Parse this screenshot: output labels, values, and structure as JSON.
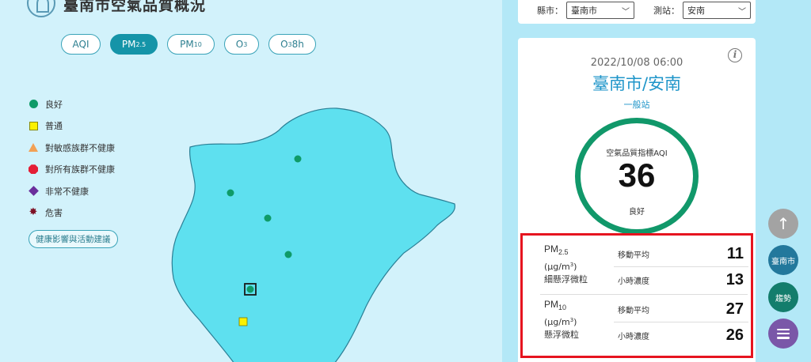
{
  "header": {
    "title": "臺南市空氣品質概況",
    "logo_icon": "leaf-logo-icon"
  },
  "tabs": [
    {
      "main": "AQI",
      "sub": ""
    },
    {
      "main": "PM",
      "sub": "2.5"
    },
    {
      "main": "PM",
      "sub": "10"
    },
    {
      "main": "O",
      "sub": "3"
    },
    {
      "main": "O",
      "sub": "3",
      "suffix": " 8h"
    }
  ],
  "active_tab_index": 1,
  "legend": {
    "items": [
      {
        "label": "良好",
        "marker": "green-circle",
        "color": "#0f9b68"
      },
      {
        "label": "普通",
        "marker": "yellow-square",
        "color": "#fcf100"
      },
      {
        "label": "對敏感族群不健康",
        "marker": "orange-triangle",
        "color": "#f2a155"
      },
      {
        "label": "對所有族群不健康",
        "marker": "red-octagon",
        "color": "#e41e36"
      },
      {
        "label": "非常不健康",
        "marker": "purple-diamond",
        "color": "#6a2e9c"
      },
      {
        "label": "危害",
        "marker": "maroon-star",
        "color": "#7d1125"
      }
    ],
    "health_link": "健康影響與活動建議"
  },
  "map": {
    "region_color": "#5ee0ef",
    "stations": [
      {
        "status": "good",
        "marker": "green-circle"
      },
      {
        "status": "good",
        "marker": "green-circle"
      },
      {
        "status": "good",
        "marker": "green-circle"
      },
      {
        "status": "good",
        "marker": "green-circle"
      },
      {
        "status": "good",
        "marker": "green-circle",
        "selected": true
      },
      {
        "status": "moderate",
        "marker": "yellow-square"
      }
    ]
  },
  "selector": {
    "county_label": "縣市：",
    "county_value": "臺南市",
    "station_label": "測站：",
    "station_value": "安南"
  },
  "station": {
    "timestamp": "2022/10/08 06:00",
    "name": "臺南市/安南",
    "type": "一般站",
    "aqi_label": "空氣品質指標AQI",
    "aqi_value": "36",
    "aqi_status": "良好",
    "aqi_color": "#11986a"
  },
  "pm": [
    {
      "name": "PM",
      "name_sub": "2.5",
      "unit_prefix": "(μg/m",
      "unit_sup": "3",
      "unit_suffix": ")",
      "desc": "細懸浮微粒",
      "rows": [
        {
          "label": "移動平均",
          "value": "11"
        },
        {
          "label": "小時濃度",
          "value": "13"
        }
      ]
    },
    {
      "name": "PM",
      "name_sub": "10",
      "unit_prefix": "(μg/m",
      "unit_sup": "3",
      "unit_suffix": ")",
      "desc": "懸浮微粒",
      "rows": [
        {
          "label": "移動平均",
          "value": "27"
        },
        {
          "label": "小時濃度",
          "value": "26"
        }
      ]
    }
  ],
  "fabs": {
    "top_icon": "arrow-up-icon",
    "city_label": "臺南市",
    "trend_label": "趨勢",
    "menu_icon": "menu-icon"
  }
}
